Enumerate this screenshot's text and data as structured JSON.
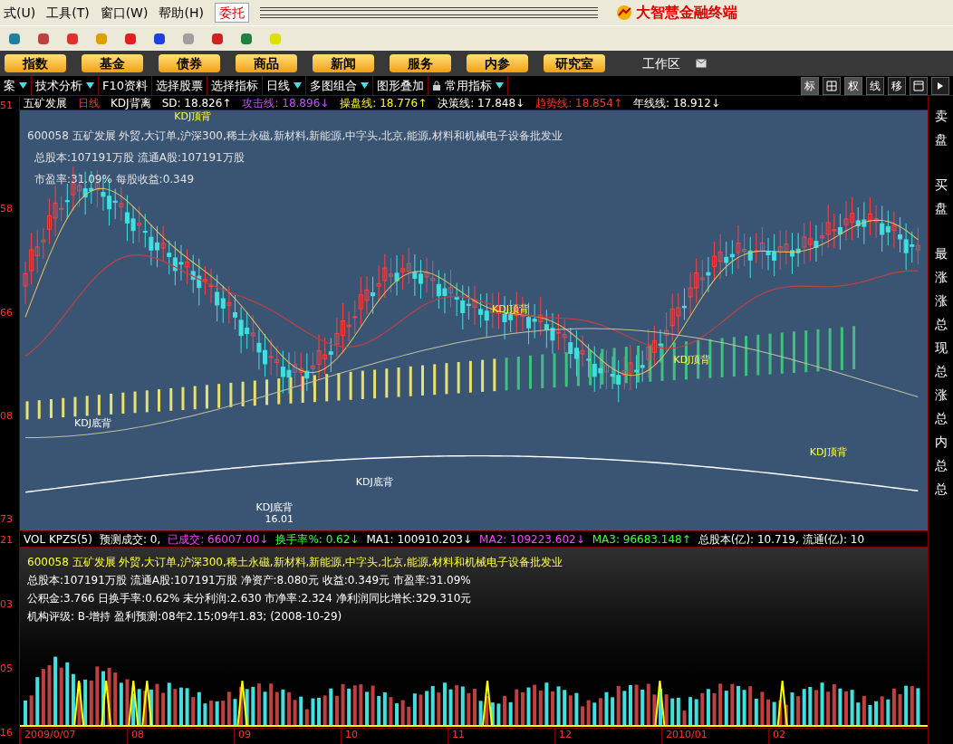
{
  "menu": [
    "式(U)",
    "工具(T)",
    "窗口(W)",
    "帮助(H)"
  ],
  "trade_button": "委托",
  "app_title": "大智慧金融终端",
  "nav_buttons": [
    "指数",
    "基金",
    "债券",
    "商品",
    "新闻",
    "服务",
    "内参",
    "研究室"
  ],
  "workspace": "工作区",
  "toolbar2": [
    {
      "label": "案",
      "dropdown": true
    },
    {
      "label": "技术分析",
      "dropdown": true
    },
    {
      "label": "F10资料",
      "dropdown": false
    },
    {
      "label": "选择股票",
      "dropdown": false
    },
    {
      "label": "选择指标",
      "dropdown": false
    },
    {
      "label": "日线",
      "dropdown": true
    },
    {
      "label": "多图组合",
      "dropdown": true
    },
    {
      "label": "图形叠加",
      "dropdown": false
    },
    {
      "label": "常用指标",
      "dropdown": true
    }
  ],
  "view_buttons": [
    {
      "kind": "text",
      "label": "标",
      "selected": true
    },
    {
      "kind": "grid",
      "selected": false
    },
    {
      "kind": "text",
      "label": "权",
      "selected": true
    },
    {
      "kind": "text",
      "label": "线",
      "selected": false
    },
    {
      "kind": "text",
      "label": "移",
      "selected": false
    },
    {
      "kind": "window",
      "selected": false
    },
    {
      "kind": "play",
      "selected": false
    }
  ],
  "chart_header": {
    "stock": "五矿发展",
    "period": "日线",
    "indicator": "KDJ背离",
    "readings": [
      {
        "text": "SD: 18.826↑",
        "color": "#ffffff"
      },
      {
        "text": "攻击线: 18.896↓",
        "color": "#c050ff"
      },
      {
        "text": "操盘线: 18.776↑",
        "color": "#ffff00"
      },
      {
        "text": "决策线: 17.848↓",
        "color": "#ffffff"
      },
      {
        "text": "趋势线: 18.854↑",
        "color": "#ff3030"
      },
      {
        "text": "年线线: 18.912↓",
        "color": "#ffffff"
      }
    ]
  },
  "price_axis": [
    "51",
    "58",
    "66",
    "08",
    "73"
  ],
  "chart_info": {
    "concepts": "600058 五矿发展 外贸,大订单,沪深300,稀土永磁,新材料,新能源,中字头,北京,能源,材料和机械电子设备批发业",
    "lines": [
      "总股本:107191万股 流通A股:107191万股",
      "市盈率:31.09% 每股收益:0.349"
    ]
  },
  "chart_labels": [
    "KDJ顶背",
    "KDJ顶背",
    "KDJ顶背",
    "KDJ顶背",
    "KDJ底背",
    "KDJ底背",
    "KDJ底背",
    "16.01"
  ],
  "side_panel": [
    "卖",
    "盘",
    "买",
    "盘",
    "最",
    "涨",
    "涨",
    "总",
    "现",
    "总",
    "涨",
    "总",
    "内",
    "总",
    "总"
  ],
  "volume_header": [
    {
      "text": "VOL KPZS(5)",
      "kind": "plain"
    },
    {
      "text": "预测成交: 0,",
      "kind": "plain"
    },
    {
      "text": "已成交: 66007.00↓",
      "kind": "traded"
    },
    {
      "text": "换手率%: 0.62↓",
      "kind": "turnover"
    },
    {
      "text": "MA1: 100910.203↓",
      "kind": "plain"
    },
    {
      "text": "MA2: 109223.602↓",
      "kind": "traded"
    },
    {
      "text": "MA3: 96683.148↑",
      "kind": "turnover"
    },
    {
      "text": "总股本(亿): 10.719, 流通(亿): 10",
      "kind": "plain"
    }
  ],
  "volume_info": {
    "concepts": "600058 五矿发展 外贸,大订单,沪深300,稀土永磁,新材料,新能源,中字头,北京,能源,材料和机械电子设备批发业",
    "lines": [
      "总股本:107191万股 流通A股:107191万股  净资产:8.080元  收益:0.349元  市盈率:31.09%",
      "公积金:3.766  日换手率:0.62%  未分利润:2.630  市净率:2.324  净利润同比增长:329.310元",
      "机构评级: B-增持 盈利预测:08年2.15;09年1.83; (2008-10-29)"
    ]
  },
  "volume_axis": [
    "21",
    "03",
    "05",
    "16"
  ],
  "date_axis": [
    "2009/0/07",
    "08",
    "09",
    "10",
    "11",
    "12",
    "2010/01",
    "02"
  ]
}
